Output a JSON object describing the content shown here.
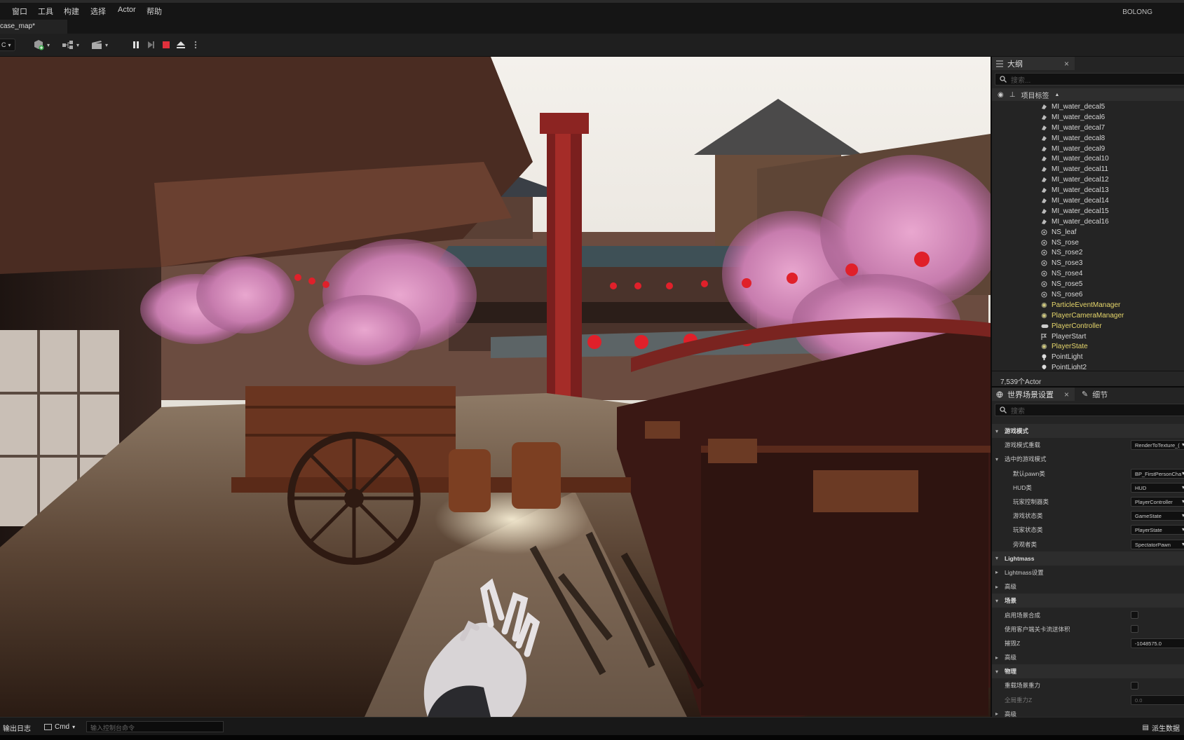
{
  "menu": {
    "items": [
      "窗口",
      "工具",
      "构建",
      "选择",
      "Actor",
      "帮助"
    ],
    "user": "BOLONG"
  },
  "tab": {
    "label": "case_map*"
  },
  "outliner": {
    "title": "大纲",
    "search_placeholder": "搜索...",
    "header_label": "项目标签",
    "items": [
      {
        "label": "MI_water_decal5",
        "icon": "decal-icon",
        "highlight": false
      },
      {
        "label": "MI_water_decal6",
        "icon": "decal-icon",
        "highlight": false
      },
      {
        "label": "MI_water_decal7",
        "icon": "decal-icon",
        "highlight": false
      },
      {
        "label": "MI_water_decal8",
        "icon": "decal-icon",
        "highlight": false
      },
      {
        "label": "MI_water_decal9",
        "icon": "decal-icon",
        "highlight": false
      },
      {
        "label": "MI_water_decal10",
        "icon": "decal-icon",
        "highlight": false
      },
      {
        "label": "MI_water_decal11",
        "icon": "decal-icon",
        "highlight": false
      },
      {
        "label": "MI_water_decal12",
        "icon": "decal-icon",
        "highlight": false
      },
      {
        "label": "MI_water_decal13",
        "icon": "decal-icon",
        "highlight": false
      },
      {
        "label": "MI_water_decal14",
        "icon": "decal-icon",
        "highlight": false
      },
      {
        "label": "MI_water_decal15",
        "icon": "decal-icon",
        "highlight": false
      },
      {
        "label": "MI_water_decal16",
        "icon": "decal-icon",
        "highlight": false
      },
      {
        "label": "NS_leaf",
        "icon": "niagara-icon",
        "highlight": false
      },
      {
        "label": "NS_rose",
        "icon": "niagara-icon",
        "highlight": false
      },
      {
        "label": "NS_rose2",
        "icon": "niagara-icon",
        "highlight": false
      },
      {
        "label": "NS_rose3",
        "icon": "niagara-icon",
        "highlight": false
      },
      {
        "label": "NS_rose4",
        "icon": "niagara-icon",
        "highlight": false
      },
      {
        "label": "NS_rose5",
        "icon": "niagara-icon",
        "highlight": false
      },
      {
        "label": "NS_rose6",
        "icon": "niagara-icon",
        "highlight": false
      },
      {
        "label": "ParticleEventManager",
        "icon": "actor-icon",
        "highlight": true
      },
      {
        "label": "PlayerCameraManager",
        "icon": "actor-icon",
        "highlight": true
      },
      {
        "label": "PlayerController",
        "icon": "gamepad-icon",
        "highlight": true
      },
      {
        "label": "PlayerStart",
        "icon": "flag-icon",
        "highlight": false
      },
      {
        "label": "PlayerState",
        "icon": "actor-icon",
        "highlight": true
      },
      {
        "label": "PointLight",
        "icon": "pointlight-icon",
        "highlight": false
      },
      {
        "label": "PointLight2",
        "icon": "pointlight-icon",
        "highlight": false
      }
    ],
    "count": "7,539个Actor"
  },
  "details": {
    "tab_world": "世界场景设置",
    "tab_details": "细节",
    "search_placeholder": "搜索",
    "rows": [
      {
        "type": "cat",
        "label": "游戏模式",
        "expanded": true
      },
      {
        "type": "prop",
        "label": "游戏模式重载",
        "indent": 1,
        "value": "RenderToTexture_(",
        "kind": "drop"
      },
      {
        "type": "cat",
        "label": "选中的游戏模式",
        "expanded": true,
        "sub": true
      },
      {
        "type": "prop",
        "label": "默认pawn类",
        "indent": 2,
        "value": "BP_FirstPersonCha",
        "kind": "drop"
      },
      {
        "type": "prop",
        "label": "HUD类",
        "indent": 2,
        "value": "HUD",
        "kind": "drop"
      },
      {
        "type": "prop",
        "label": "玩家控制器类",
        "indent": 2,
        "value": "PlayerController",
        "kind": "drop"
      },
      {
        "type": "prop",
        "label": "游戏状态类",
        "indent": 2,
        "value": "GameState",
        "kind": "drop"
      },
      {
        "type": "prop",
        "label": "玩家状态类",
        "indent": 2,
        "value": "PlayerState",
        "kind": "drop"
      },
      {
        "type": "prop",
        "label": "旁观者类",
        "indent": 2,
        "value": "SpectatorPawn",
        "kind": "drop"
      },
      {
        "type": "cat",
        "label": "Lightmass",
        "expanded": true
      },
      {
        "type": "cat",
        "label": "Lightmass设置",
        "expanded": false,
        "sub": true
      },
      {
        "type": "cat",
        "label": "高级",
        "expanded": false,
        "sub": true
      },
      {
        "type": "cat",
        "label": "场景",
        "expanded": true
      },
      {
        "type": "prop",
        "label": "启用场景合成",
        "indent": 1,
        "kind": "check"
      },
      {
        "type": "prop",
        "label": "使用客户端关卡流送体积",
        "indent": 1,
        "kind": "check"
      },
      {
        "type": "prop",
        "label": "摧毁Z",
        "indent": 1,
        "value": "-1048575.0",
        "kind": "num"
      },
      {
        "type": "cat",
        "label": "高级",
        "expanded": false,
        "sub": true
      },
      {
        "type": "cat",
        "label": "物理",
        "expanded": true
      },
      {
        "type": "prop",
        "label": "重载场景重力",
        "indent": 1,
        "kind": "check"
      },
      {
        "type": "prop",
        "label": "全局重力Z",
        "indent": 1,
        "value": "0.0",
        "kind": "num",
        "dim": true
      },
      {
        "type": "cat",
        "label": "高级",
        "expanded": false,
        "sub": true
      }
    ]
  },
  "status": {
    "output_log": "输出日志",
    "cmd": "Cmd",
    "console_placeholder": "输入控制台命令",
    "derived_data": "派生数据"
  },
  "colors": {
    "accent_yellow": "#e6d66b",
    "stop_red": "#e0303c",
    "panel_bg": "#242424"
  }
}
